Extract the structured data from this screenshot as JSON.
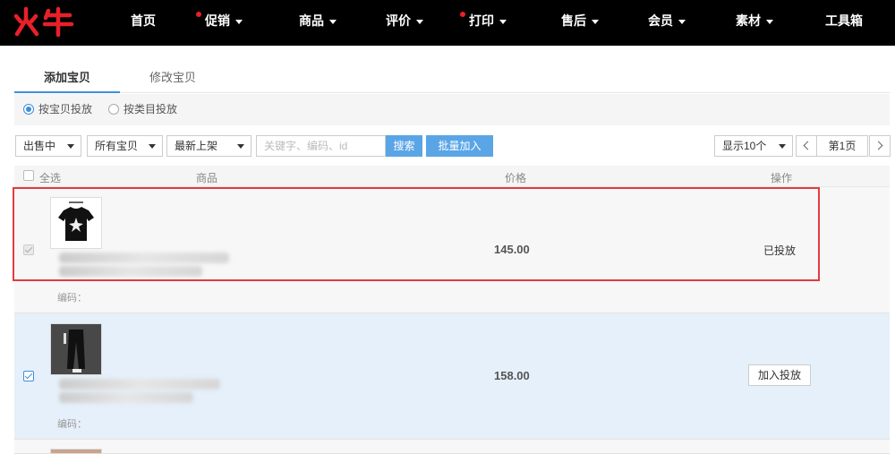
{
  "brand": {
    "logo_text": "火牛",
    "accent": "#e8202a"
  },
  "nav": {
    "items": [
      {
        "label": "首页",
        "dropdown": false,
        "dot": false
      },
      {
        "label": "促销",
        "dropdown": true,
        "dot": true
      },
      {
        "label": "商品",
        "dropdown": true,
        "dot": false
      },
      {
        "label": "评价",
        "dropdown": true,
        "dot": false
      },
      {
        "label": "打印",
        "dropdown": true,
        "dot": true
      },
      {
        "label": "售后",
        "dropdown": true,
        "dot": false
      },
      {
        "label": "会员",
        "dropdown": true,
        "dot": false
      },
      {
        "label": "素材",
        "dropdown": true,
        "dot": false
      },
      {
        "label": "工具箱",
        "dropdown": false,
        "dot": false
      }
    ]
  },
  "tabs": {
    "active": "添加宝贝",
    "inactive": "修改宝贝"
  },
  "radios": {
    "by_item": "按宝贝投放",
    "by_category": "按类目投放",
    "selected": "by_item"
  },
  "filters": {
    "status": "出售中",
    "scope": "所有宝贝",
    "sort": "最新上架",
    "search_placeholder": "关键字、编码、id",
    "search_button": "搜索",
    "batch_button": "批量加入",
    "page_size": "显示10个",
    "page": "第1页"
  },
  "table": {
    "headers": {
      "select_all": "全选",
      "item": "商品",
      "price": "价格",
      "action": "操作"
    },
    "rows": [
      {
        "price": "145.00",
        "status": "已投放",
        "code_label": "编码：",
        "checked": true,
        "disabled": true
      },
      {
        "price": "158.00",
        "action": "加入投放",
        "code_label": "编码：",
        "checked": true,
        "disabled": false
      }
    ]
  }
}
